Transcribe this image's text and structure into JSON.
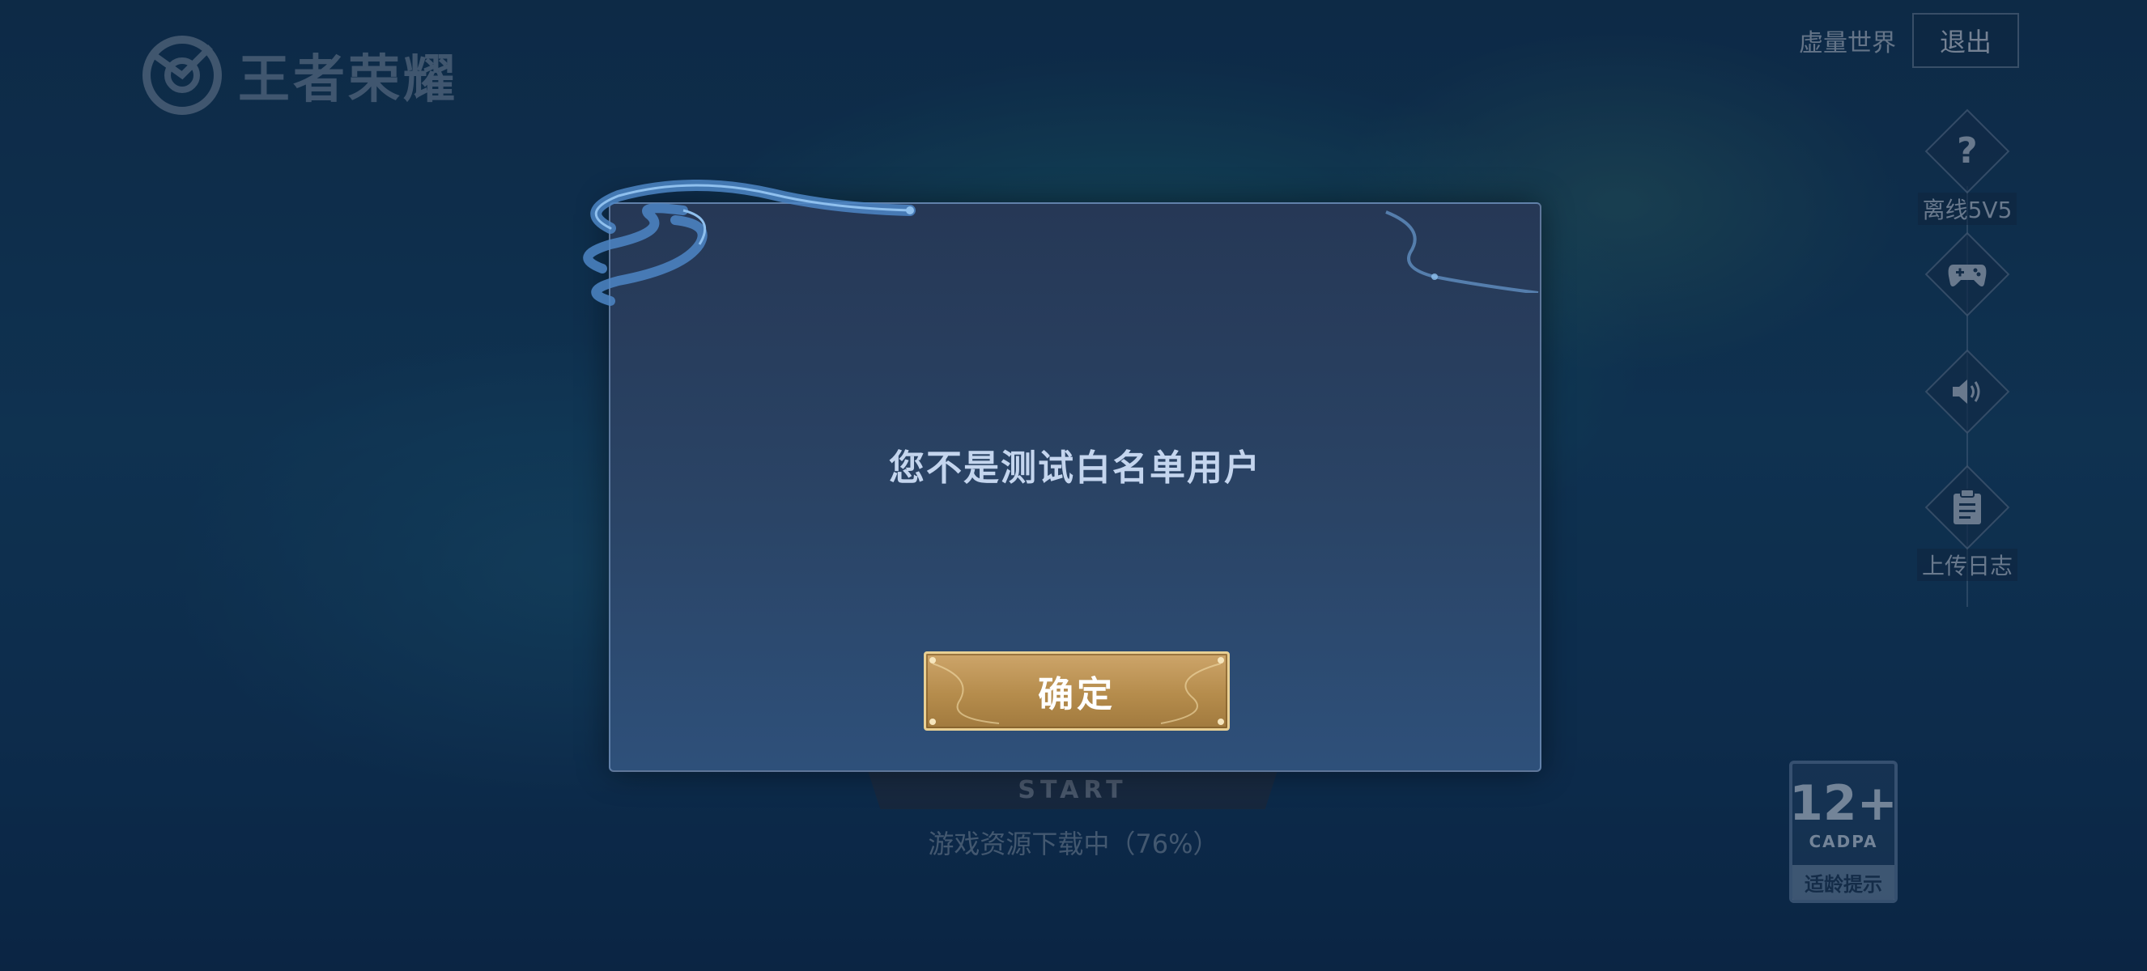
{
  "logo": {
    "text": "王者荣耀"
  },
  "top_bar": {
    "world_label": "虚量世界",
    "exit_label": "退出"
  },
  "side_menu": {
    "items": [
      {
        "glyph": "?",
        "label": "离线5V5",
        "icon": "question-icon"
      },
      {
        "glyph": "",
        "label": "",
        "icon": "gamepad-icon"
      },
      {
        "glyph": "",
        "label": "",
        "icon": "speaker-icon"
      },
      {
        "glyph": "",
        "label": "上传日志",
        "icon": "clipboard-icon"
      }
    ]
  },
  "start_button": {
    "label": "START"
  },
  "download_status": "游戏资源下载中（76%）",
  "age_rating": {
    "age": "12+",
    "org": "CADPA",
    "tip": "适龄提示"
  },
  "modal": {
    "message": "您不是测试白名单用户",
    "confirm_label": "确定"
  },
  "colors": {
    "modal_bg": "#2a4466",
    "confirm_gold": "#b58c4c",
    "confirm_border": "#e8cf93"
  }
}
